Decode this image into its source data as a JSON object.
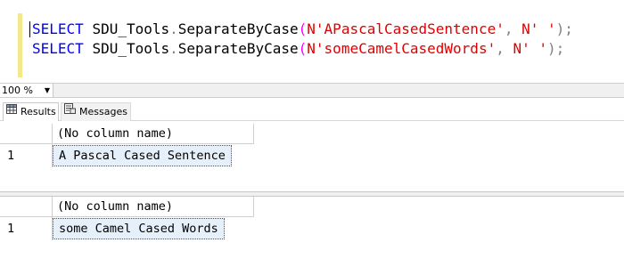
{
  "editor": {
    "line1": {
      "keyword": "SELECT",
      "object": "SDU_Tools",
      "dot": ".",
      "function": "SeparateByCase",
      "open_paren": "(",
      "arg1": "N'APascalCasedSentence'",
      "comma": ", ",
      "arg2": "N' '",
      "close": ");"
    },
    "line2": {
      "keyword": "SELECT",
      "object": "SDU_Tools",
      "dot": ".",
      "function": "SeparateByCase",
      "open_paren": "(",
      "arg1": "N'someCamelCasedWords'",
      "comma": ", ",
      "arg2": "N' '",
      "close": ");"
    }
  },
  "zoom": {
    "value": "100 %"
  },
  "tabs": [
    {
      "label": "Results",
      "icon": "grid-icon",
      "active": true
    },
    {
      "label": "Messages",
      "icon": "messages-icon",
      "active": false
    }
  ],
  "result_sets": [
    {
      "column_header": "(No column name)",
      "rows": [
        {
          "num": "1",
          "value": "A Pascal Cased Sentence"
        }
      ]
    },
    {
      "column_header": "(No column name)",
      "rows": [
        {
          "num": "1",
          "value": "some Camel Cased Words"
        }
      ]
    }
  ],
  "colors": {
    "keyword": "#0000ff",
    "string": "#e00000",
    "function_paren": "#ff00ff",
    "punctuation": "#808080",
    "selected_cell": "#e6f0fa"
  }
}
